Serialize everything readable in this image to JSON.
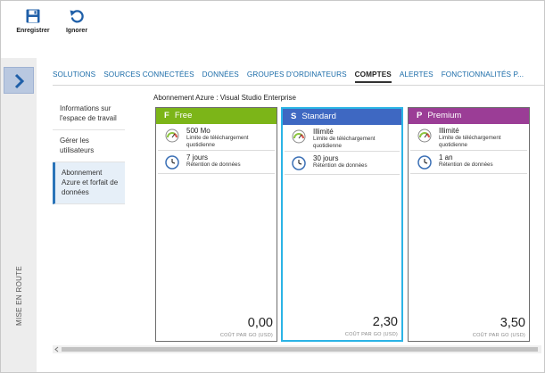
{
  "toolbar": {
    "save_label": "Enregistrer",
    "discard_label": "Ignorer"
  },
  "rail": {
    "label": "MISE EN ROUTE"
  },
  "tabs": [
    {
      "label": "SOLUTIONS",
      "active": false
    },
    {
      "label": "SOURCES CONNECTÉES",
      "active": false
    },
    {
      "label": "DONNÉES",
      "active": false
    },
    {
      "label": "GROUPES D'ORDINATEURS",
      "active": false
    },
    {
      "label": "COMPTES",
      "active": true
    },
    {
      "label": "ALERTES",
      "active": false
    },
    {
      "label": "FONCTIONNALITÉS P...",
      "active": false
    }
  ],
  "sidenav": [
    {
      "label": "Informations sur l'espace de travail",
      "active": false
    },
    {
      "label": "Gérer les utilisateurs",
      "active": false
    },
    {
      "label": "Abonnement Azure et forfait de données",
      "active": true
    }
  ],
  "subscription_title": "Abonnement Azure : Visual Studio Enterprise",
  "plans": [
    {
      "letter": "F",
      "name": "Free",
      "color": "#7cb518",
      "selected": false,
      "upload_value": "500 Mo",
      "upload_desc": "Limite de téléchargement quotidienne",
      "retention_value": "7 jours",
      "retention_desc": "Rétention de données",
      "price": "0,00",
      "price_label": "COÛT PAR GO (USD)"
    },
    {
      "letter": "S",
      "name": "Standard",
      "color": "#3e68c2",
      "selected": true,
      "upload_value": "Illimité",
      "upload_desc": "Limite de téléchargement quotidienne",
      "retention_value": "30 jours",
      "retention_desc": "Rétention de données",
      "price": "2,30",
      "price_label": "COÛT PAR GO (USD)"
    },
    {
      "letter": "P",
      "name": "Premium",
      "color": "#9b3d96",
      "selected": false,
      "upload_value": "Illimité",
      "upload_desc": "Limite de téléchargement quotidienne",
      "retention_value": "1 an",
      "retention_desc": "Rétention de données",
      "price": "3,50",
      "price_label": "COÛT PAR GO (USD)"
    }
  ],
  "icons": {
    "save": "save-icon",
    "discard": "undo-icon",
    "expand": "chevron-right-icon",
    "upload_limit": "gauge-icon",
    "retention": "clock-icon"
  },
  "colors": {
    "accent_blue": "#1a6ba8",
    "save_icon": "#1f5fa8",
    "selected_border": "#2bb4e6",
    "rail_button": "#b9c8e0"
  }
}
